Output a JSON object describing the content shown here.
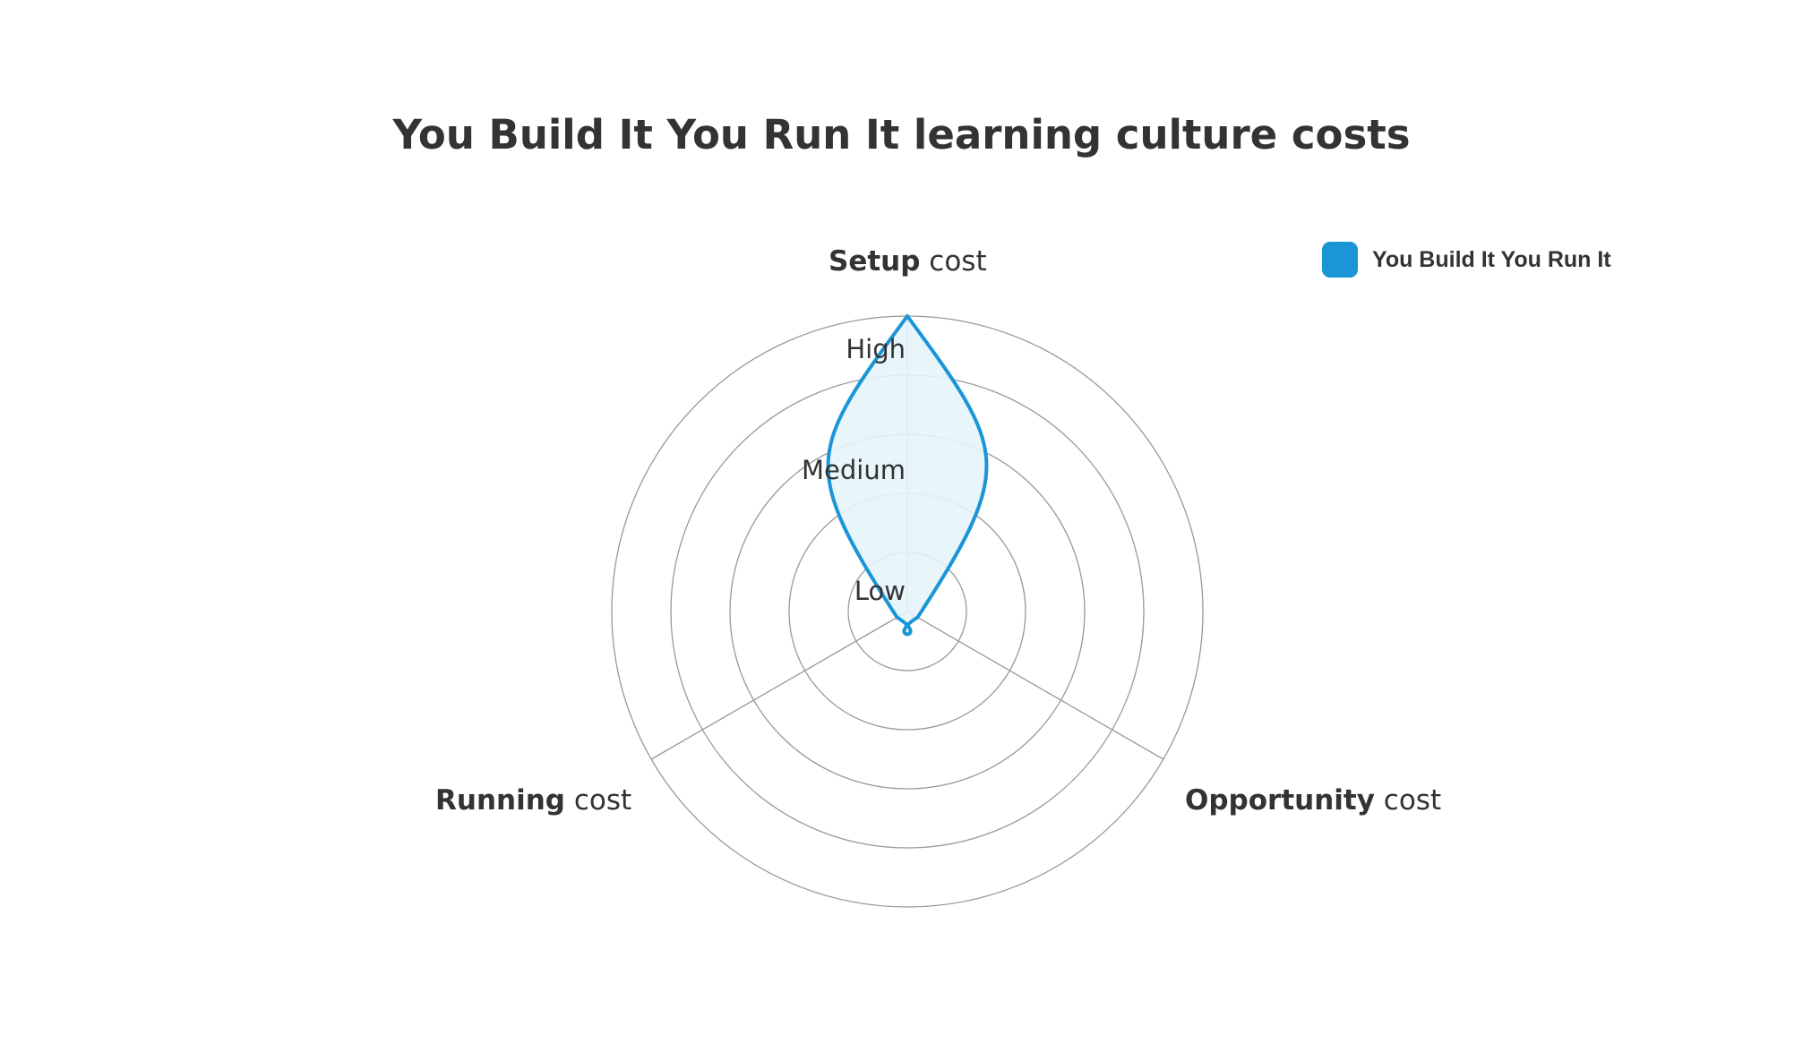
{
  "chart_data": {
    "type": "radar",
    "title": "You Build It You Run It learning culture costs",
    "axes": [
      {
        "bold": "Setup",
        "rest": " cost"
      },
      {
        "bold": "Opportunity",
        "rest": " cost"
      },
      {
        "bold": "Running",
        "rest": " cost"
      }
    ],
    "scale_labels": [
      "Low",
      "Medium",
      "High"
    ],
    "scale_values": [
      1,
      2,
      3
    ],
    "rings": 5,
    "range": [
      0,
      5
    ],
    "series": [
      {
        "name": "You Build It You Run It",
        "values": [
          5,
          0.2,
          0.2
        ],
        "color": "#1a95d6",
        "fill": "#e6f4fb"
      }
    ],
    "grid_color": "#999999",
    "legend_position": "top-right"
  }
}
